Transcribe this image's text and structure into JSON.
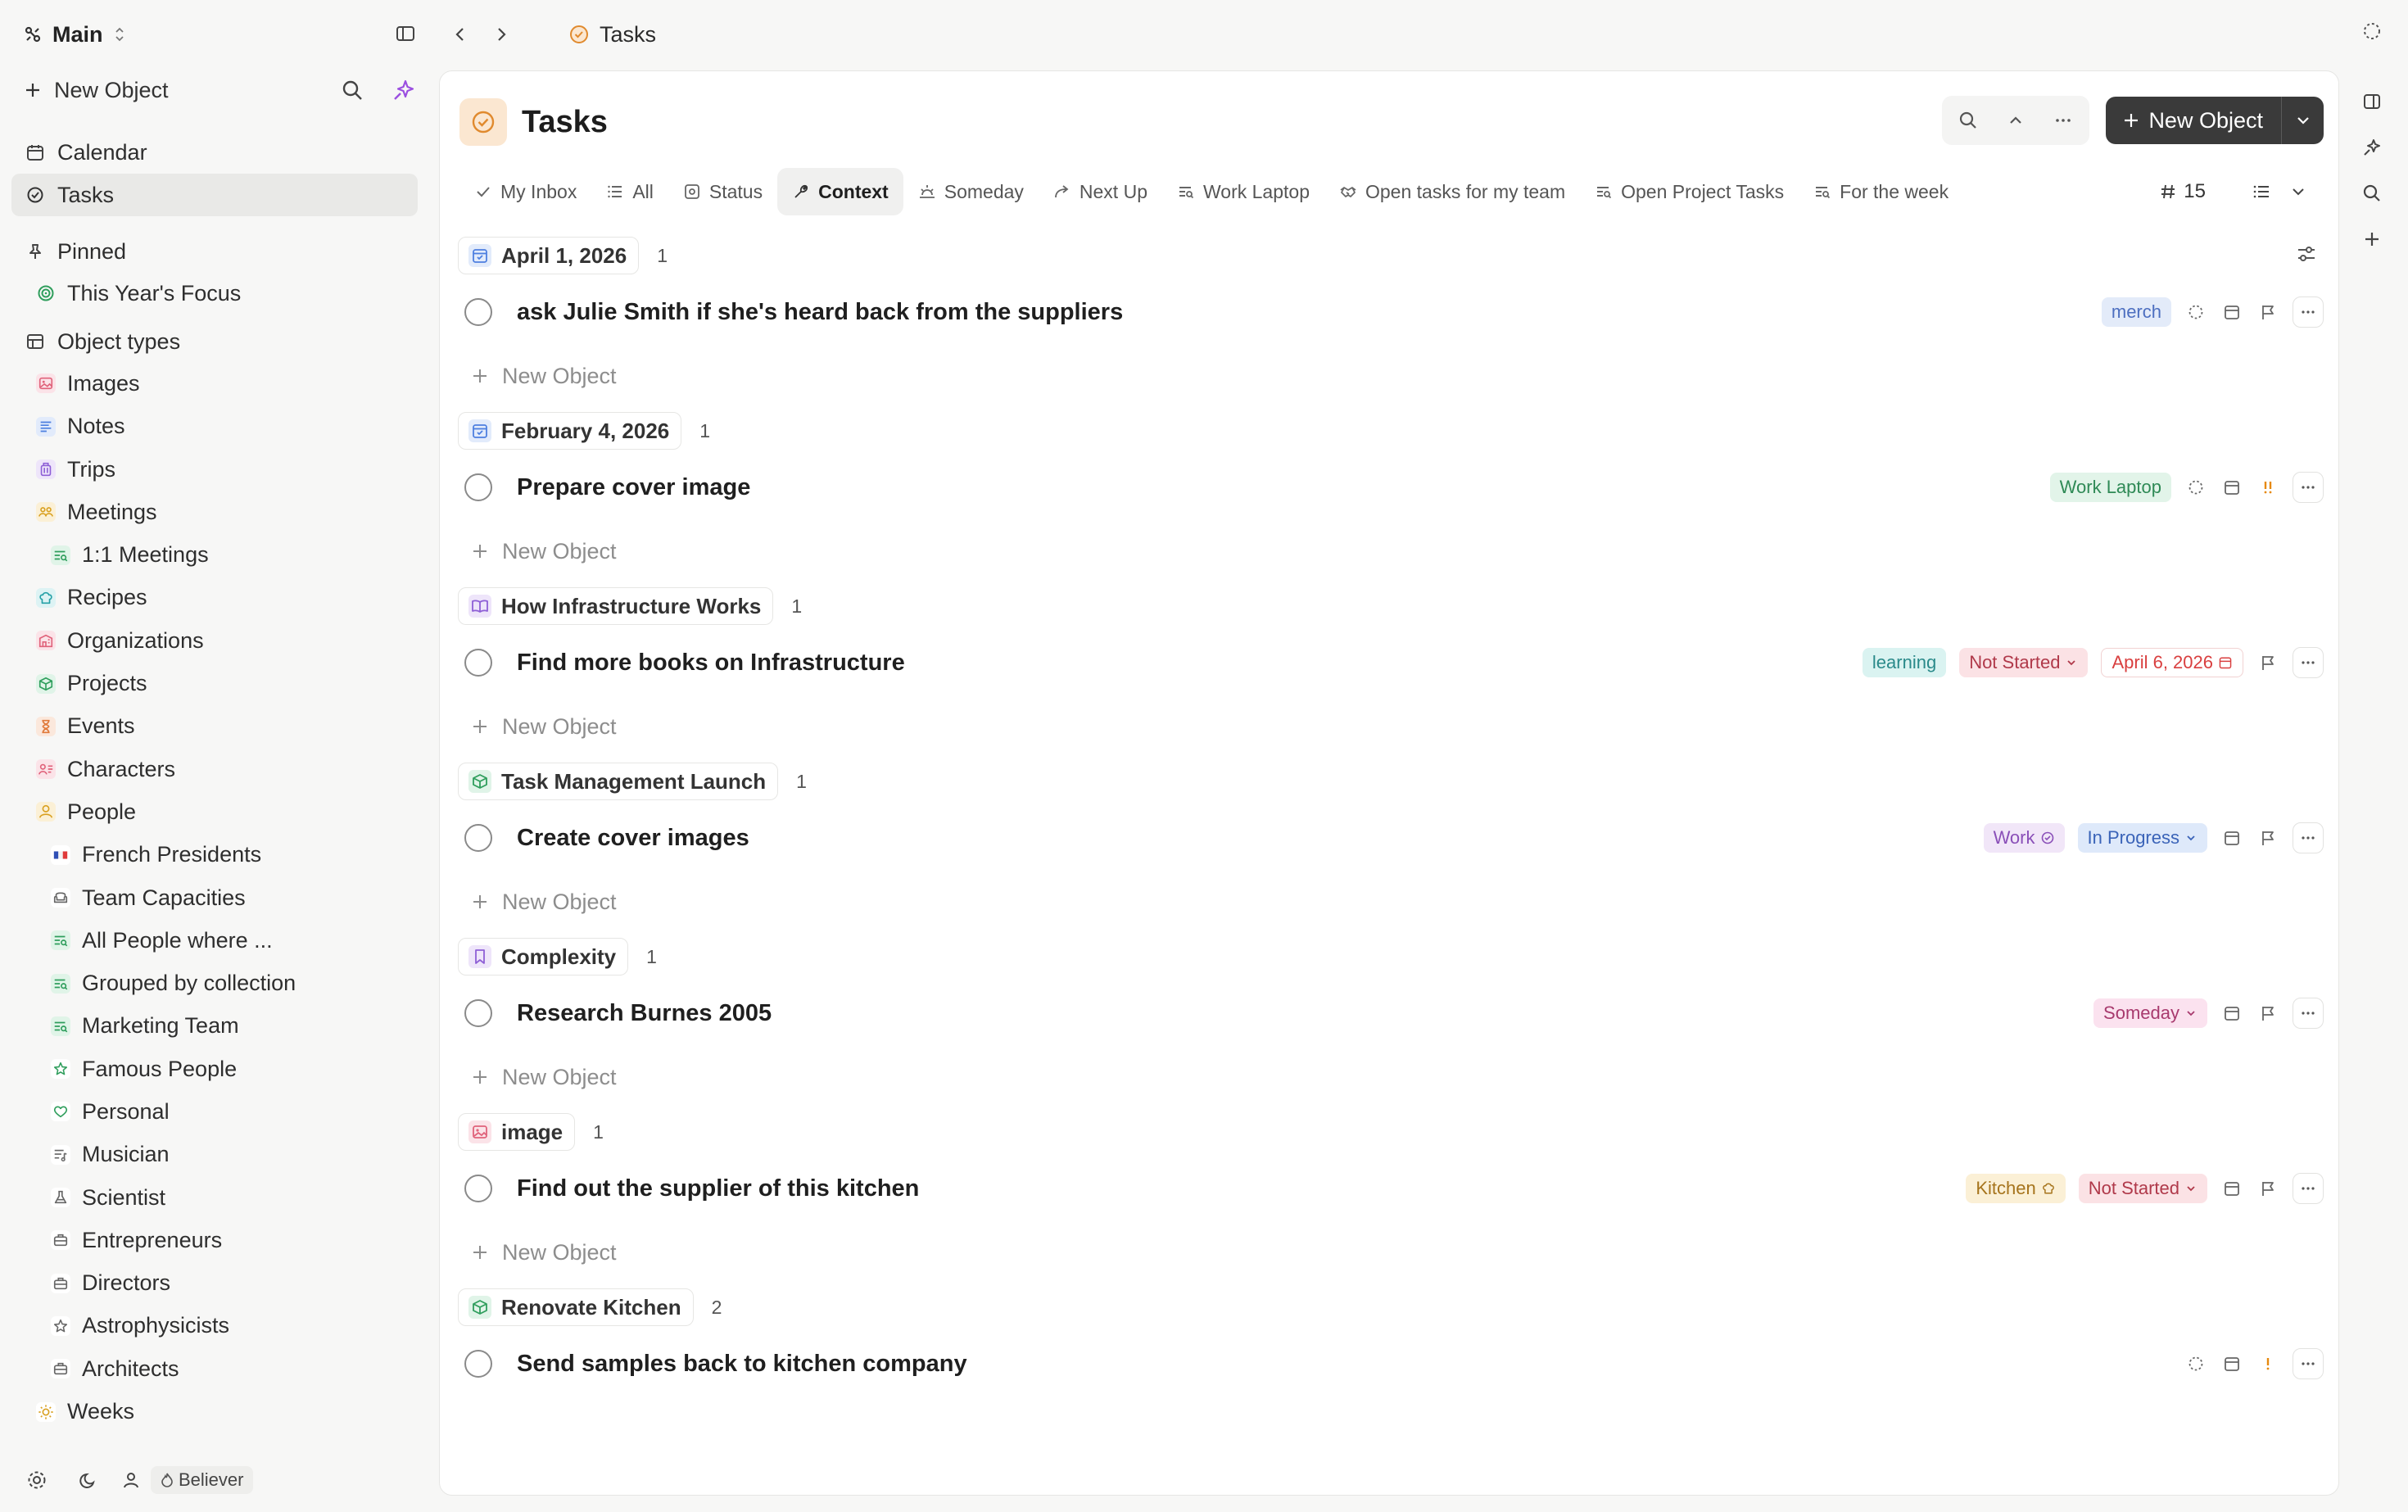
{
  "app": {
    "workspace": "Main",
    "new_object_label": "New Object"
  },
  "breadcrumb": {
    "title": "Tasks"
  },
  "sidebar": {
    "nav": [
      {
        "label": "Calendar",
        "icon": "calendar-icon"
      },
      {
        "label": "Tasks",
        "icon": "task-check-icon",
        "active": true
      }
    ],
    "pinned_label": "Pinned",
    "pinned": [
      {
        "label": "This Year's Focus",
        "icon": "target-icon",
        "color": "#2f9e5c"
      }
    ],
    "object_types_label": "Object types",
    "object_types": [
      {
        "label": "Images",
        "icon": "image-icon",
        "color": "#e0627a",
        "bg": "#fbe3e8",
        "level": 1
      },
      {
        "label": "Notes",
        "icon": "notes-icon",
        "color": "#4d7fe0",
        "bg": "#e2ebfb",
        "level": 1
      },
      {
        "label": "Trips",
        "icon": "luggage-icon",
        "color": "#8e5fd6",
        "bg": "#eee5fa",
        "level": 1
      },
      {
        "label": "Meetings",
        "icon": "meeting-icon",
        "color": "#d9a020",
        "bg": "#fbf0d6",
        "level": 1
      },
      {
        "label": "1:1 Meetings",
        "icon": "filter-list-icon",
        "color": "#2f9e5c",
        "bg": "#e0f4e8",
        "level": 2
      },
      {
        "label": "Recipes",
        "icon": "chef-hat-icon",
        "color": "#25a0a6",
        "bg": "#ddf3f4",
        "level": 1
      },
      {
        "label": "Organizations",
        "icon": "building-icon",
        "color": "#e0627a",
        "bg": "#fbe3e8",
        "level": 1
      },
      {
        "label": "Projects",
        "icon": "box-icon",
        "color": "#2f9e5c",
        "bg": "#e0f4e8",
        "level": 1
      },
      {
        "label": "Events",
        "icon": "hourglass-icon",
        "color": "#e07a3a",
        "bg": "#fbe8dc",
        "level": 1
      },
      {
        "label": "Characters",
        "icon": "character-icon",
        "color": "#e0627a",
        "bg": "#fbe3e8",
        "level": 1
      },
      {
        "label": "People",
        "icon": "person-icon",
        "color": "#d9a020",
        "bg": "#fbf0d6",
        "level": 1
      },
      {
        "label": "French Presidents",
        "icon": "french-flag-icon",
        "color": "#3a5fc8",
        "bg": "#ffffff",
        "level": 2
      },
      {
        "label": "Team Capacities",
        "icon": "armchair-icon",
        "color": "#666666",
        "bg": "#ffffff",
        "level": 2
      },
      {
        "label": "All People where ...",
        "icon": "filter-list-icon",
        "color": "#2f9e5c",
        "bg": "#e0f4e8",
        "level": 2
      },
      {
        "label": "Grouped by collection",
        "icon": "filter-list-icon",
        "color": "#2f9e5c",
        "bg": "#e0f4e8",
        "level": 2
      },
      {
        "label": "Marketing Team",
        "icon": "filter-list-icon",
        "color": "#2f9e5c",
        "bg": "#e0f4e8",
        "level": 2
      },
      {
        "label": "Famous People",
        "icon": "star-icon",
        "color": "#2f9e5c",
        "bg": "#ffffff",
        "level": 2
      },
      {
        "label": "Personal",
        "icon": "heart-icon",
        "color": "#2f9e5c",
        "bg": "#ffffff",
        "level": 2
      },
      {
        "label": "Musician",
        "icon": "music-list-icon",
        "color": "#666666",
        "bg": "#ffffff",
        "level": 2
      },
      {
        "label": "Scientist",
        "icon": "flask-icon",
        "color": "#666666",
        "bg": "#ffffff",
        "level": 2
      },
      {
        "label": "Entrepreneurs",
        "icon": "briefcase-icon",
        "color": "#666666",
        "bg": "#ffffff",
        "level": 2
      },
      {
        "label": "Directors",
        "icon": "briefcase-icon",
        "color": "#666666",
        "bg": "#ffffff",
        "level": 2
      },
      {
        "label": "Astrophysicists",
        "icon": "star-icon",
        "color": "#666666",
        "bg": "#ffffff",
        "level": 2
      },
      {
        "label": "Architects",
        "icon": "briefcase-icon",
        "color": "#666666",
        "bg": "#ffffff",
        "level": 2
      },
      {
        "label": "Weeks",
        "icon": "sun-icon",
        "color": "#d9a020",
        "bg": "#ffffff",
        "level": 1
      }
    ],
    "footer": {
      "badge": "Believer"
    }
  },
  "main": {
    "title": "Tasks",
    "header_button": "New Object",
    "tabs": [
      {
        "label": "My Inbox",
        "icon": "check-icon"
      },
      {
        "label": "All",
        "icon": "list-icon"
      },
      {
        "label": "Status",
        "icon": "status-icon"
      },
      {
        "label": "Context",
        "icon": "wrench-icon",
        "active": true
      },
      {
        "label": "Someday",
        "icon": "sunrise-icon"
      },
      {
        "label": "Next Up",
        "icon": "forward-icon"
      },
      {
        "label": "Work Laptop",
        "icon": "filter-list-icon"
      },
      {
        "label": "Open tasks for my team",
        "icon": "handshake-icon"
      },
      {
        "label": "Open Project Tasks",
        "icon": "filter-list-icon"
      },
      {
        "label": "For the week",
        "icon": "filter-list-icon"
      }
    ],
    "tab_count": "15",
    "new_row_label": "New Object",
    "groups": [
      {
        "name": "April 1, 2026",
        "count": "1",
        "icon": "calendar-check-icon",
        "icon_color": "#4d7fe0",
        "icon_bg": "#e2ebfb",
        "tasks": [
          {
            "title": "ask Julie Smith if she's heard back from the suppliers",
            "pills": [
              {
                "text": "merch",
                "color": "#4d6fc0",
                "bg": "#e3ebf9"
              }
            ],
            "icons": [
              "status-dashed-icon",
              "calendar-icon",
              "flag-icon"
            ]
          }
        ]
      },
      {
        "name": "February 4, 2026",
        "count": "1",
        "icon": "calendar-check-icon",
        "icon_color": "#4d7fe0",
        "icon_bg": "#e2ebfb",
        "tasks": [
          {
            "title": "Prepare cover image",
            "pills": [
              {
                "text": "Work Laptop",
                "color": "#2f8a56",
                "bg": "#e2f4e9"
              }
            ],
            "icons": [
              "status-dashed-icon",
              "calendar-icon",
              "priority-high-icon"
            ]
          }
        ]
      },
      {
        "name": "How Infrastructure Works",
        "count": "1",
        "icon": "book-icon",
        "icon_color": "#8e5fd6",
        "icon_bg": "#eee5fa",
        "tasks": [
          {
            "title": "Find more books on Infrastructure",
            "pills": [
              {
                "text": "learning",
                "color": "#2a8a8a",
                "bg": "#daf3f1"
              },
              {
                "text": "Not Started",
                "color": "#b0394a",
                "bg": "#fbe2e5",
                "dropdown": true
              },
              {
                "text": "April 6, 2026",
                "color": "#d93f3f",
                "bg": "#ffffff",
                "date": true
              }
            ],
            "icons": [
              "flag-icon"
            ]
          }
        ]
      },
      {
        "name": "Task Management Launch",
        "count": "1",
        "icon": "box-icon",
        "icon_color": "#2f9e5c",
        "icon_bg": "#e0f4e8",
        "tasks": [
          {
            "title": "Create cover images",
            "pills": [
              {
                "text": "Work",
                "color": "#8a4fb8",
                "bg": "#f1e6f8",
                "check": true
              },
              {
                "text": "In Progress",
                "color": "#3a63b8",
                "bg": "#dee9fa",
                "dropdown": true
              }
            ],
            "icons": [
              "calendar-icon",
              "flag-icon"
            ]
          }
        ]
      },
      {
        "name": "Complexity",
        "count": "1",
        "icon": "bookmark-icon",
        "icon_color": "#8e5fd6",
        "icon_bg": "#eee5fa",
        "tasks": [
          {
            "title": "Research Burnes 2005",
            "pills": [
              {
                "text": "Someday",
                "color": "#a83a6e",
                "bg": "#fbe2ef",
                "dropdown": true
              }
            ],
            "icons": [
              "calendar-icon",
              "flag-icon"
            ]
          }
        ]
      },
      {
        "name": "image",
        "count": "1",
        "icon": "image-icon",
        "icon_color": "#e0627a",
        "icon_bg": "#fbe3e8",
        "tasks": [
          {
            "title": "Find out the supplier of this kitchen",
            "pills": [
              {
                "text": "Kitchen",
                "color": "#a6741c",
                "bg": "#fbf0d6",
                "chef": true
              },
              {
                "text": "Not Started",
                "color": "#b0394a",
                "bg": "#fbe2e5",
                "dropdown": true
              }
            ],
            "icons": [
              "calendar-icon",
              "flag-icon"
            ]
          }
        ]
      },
      {
        "name": "Renovate Kitchen",
        "count": "2",
        "icon": "box-icon",
        "icon_color": "#2f9e5c",
        "icon_bg": "#e0f4e8",
        "tasks": [
          {
            "title": "Send samples back to kitchen company",
            "pills": [],
            "icons": [
              "status-dashed-icon",
              "calendar-icon",
              "priority-medium-icon"
            ]
          }
        ]
      }
    ]
  }
}
